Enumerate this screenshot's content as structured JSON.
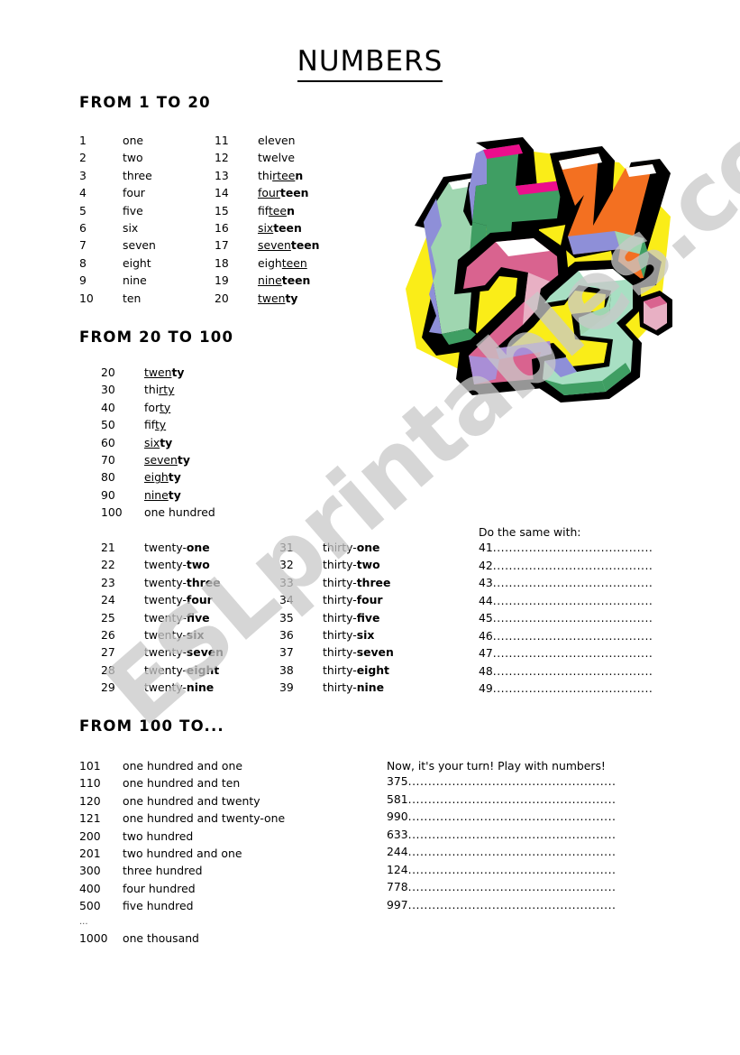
{
  "title": "NUMBERS",
  "watermark": "ESLprintables.com",
  "sections": {
    "s1": {
      "heading": "FROM 1 TO 20"
    },
    "s2": {
      "heading": "FROM 20 TO 100"
    },
    "s3": {
      "heading": "FROM 100 TO..."
    }
  },
  "list_1_10": [
    {
      "numeral": "1",
      "word": "one"
    },
    {
      "numeral": "2",
      "word": "two"
    },
    {
      "numeral": "3",
      "word": "three"
    },
    {
      "numeral": "4",
      "word": "four"
    },
    {
      "numeral": "5",
      "word": "five"
    },
    {
      "numeral": "6",
      "word": "six"
    },
    {
      "numeral": "7",
      "word": "seven"
    },
    {
      "numeral": "8",
      "word": "eight"
    },
    {
      "numeral": "9",
      "word": "nine"
    },
    {
      "numeral": "10",
      "word": "ten"
    }
  ],
  "list_11_20": [
    {
      "numeral": "11",
      "word": "eleven"
    },
    {
      "numeral": "12",
      "word": "twelve"
    },
    {
      "numeral": "13",
      "word": "thirteen"
    },
    {
      "numeral": "14",
      "word": "fourteen"
    },
    {
      "numeral": "15",
      "word": "fifteen"
    },
    {
      "numeral": "16",
      "word": "sixteen"
    },
    {
      "numeral": "17",
      "word": "seventeen"
    },
    {
      "numeral": "18",
      "word": "eighteen"
    },
    {
      "numeral": "19",
      "word": "nineteen"
    },
    {
      "numeral": "20",
      "word": "twenty"
    }
  ],
  "list_tens": [
    {
      "numeral": "20",
      "word": "twenty"
    },
    {
      "numeral": "30",
      "word": "thirty"
    },
    {
      "numeral": "40",
      "word": "forty"
    },
    {
      "numeral": "50",
      "word": "fifty"
    },
    {
      "numeral": "60",
      "word": "sixty"
    },
    {
      "numeral": "70",
      "word": "seventy"
    },
    {
      "numeral": "80",
      "word": "eighty"
    },
    {
      "numeral": "90",
      "word": "ninety"
    },
    {
      "numeral": "100",
      "word": "one hundred"
    }
  ],
  "list_twenties": [
    {
      "numeral": "21",
      "word": "twenty-one"
    },
    {
      "numeral": "22",
      "word": "twenty-two"
    },
    {
      "numeral": "23",
      "word": "twenty-three"
    },
    {
      "numeral": "24",
      "word": "twenty-four"
    },
    {
      "numeral": "25",
      "word": "twenty-five"
    },
    {
      "numeral": "26",
      "word": "twenty-six"
    },
    {
      "numeral": "27",
      "word": "twenty-seven"
    },
    {
      "numeral": "28",
      "word": "twenty-eight"
    },
    {
      "numeral": "29",
      "word": "twenty-nine"
    }
  ],
  "list_thirties": [
    {
      "numeral": "31",
      "word": "thirty-one"
    },
    {
      "numeral": "32",
      "word": "thirty-two"
    },
    {
      "numeral": "33",
      "word": "thirty-three"
    },
    {
      "numeral": "34",
      "word": "thirty-four"
    },
    {
      "numeral": "35",
      "word": "thirty-five"
    },
    {
      "numeral": "36",
      "word": "thirty-six"
    },
    {
      "numeral": "37",
      "word": "thirty-seven"
    },
    {
      "numeral": "38",
      "word": "thirty-eight"
    },
    {
      "numeral": "39",
      "word": "thirty-nine"
    }
  ],
  "list_hundreds": [
    {
      "numeral": "101",
      "word": "one hundred and one"
    },
    {
      "numeral": "110",
      "word": "one hundred and ten"
    },
    {
      "numeral": "120",
      "word": "one hundred and twenty"
    },
    {
      "numeral": "121",
      "word": "one hundred and twenty-one"
    },
    {
      "numeral": "200",
      "word": "two hundred"
    },
    {
      "numeral": "201",
      "word": "two hundred and one"
    },
    {
      "numeral": "300",
      "word": "three hundred"
    },
    {
      "numeral": "400",
      "word": "four hundred"
    },
    {
      "numeral": "500",
      "word": "five hundred"
    },
    {
      "numeral": "...",
      "word": ""
    },
    {
      "numeral": "1000",
      "word": "one thousand"
    }
  ],
  "exercise_do_same": {
    "title": "Do the same with:",
    "items": [
      "41",
      "42",
      "43",
      "44",
      "45",
      "46",
      "47",
      "48",
      "49"
    ]
  },
  "exercise_your_turn": {
    "title": "Now, it's your turn! Play with numbers!",
    "items": [
      "375",
      "581",
      "990",
      "633",
      "244",
      "124",
      "778",
      "997"
    ]
  },
  "clipart": {
    "name": "numbers-3d-clipart",
    "colors": {
      "yellow": "#faed18",
      "green_light": "#9fd6b0",
      "green_mid": "#3f9e63",
      "blue_violet": "#8e8fd8",
      "magenta": "#ec0e8c",
      "orange": "#f37021",
      "pink": "#d9638f",
      "pink_light": "#e8b0c4",
      "purple": "#a98ed6",
      "mint": "#a8dfc3",
      "white": "#ffffff",
      "outline": "#000000"
    }
  }
}
